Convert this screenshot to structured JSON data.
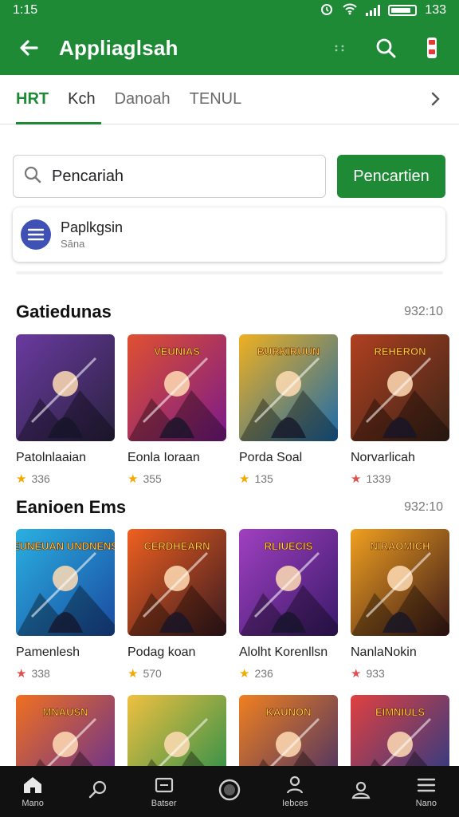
{
  "status_bar": {
    "time": "1:15",
    "battery": "133"
  },
  "app_bar": {
    "title": "Appliaglsah"
  },
  "tabs": {
    "items": [
      {
        "label": "HRT"
      },
      {
        "label": "Kch"
      },
      {
        "label": "Danoah"
      },
      {
        "label": "TENUL"
      }
    ]
  },
  "search": {
    "placeholder": "Pencariah",
    "button_label": "Pencartien"
  },
  "suggestion": {
    "title": "Paplkgsin",
    "subtitle": "Sāna"
  },
  "sections": [
    {
      "title": "Gatiedunas",
      "count": "932:10",
      "items": [
        {
          "name": "Patolnlaaian",
          "rating": "336",
          "art_label": "",
          "palette": [
            "#2a2240",
            "#6a3aa0"
          ]
        },
        {
          "name": "Eonla Ioraan",
          "rating": "355",
          "art_label": "VEUNIAS",
          "palette": [
            "#7a1a8a",
            "#e05030"
          ]
        },
        {
          "name": "Porda Soal",
          "rating": "135",
          "art_label": "BURKIRUUN",
          "palette": [
            "#1a6aaa",
            "#f0b020"
          ]
        },
        {
          "name": "Norvarlicah",
          "rating": "1339",
          "art_label": "REHERON",
          "palette": [
            "#3a2418",
            "#b04020"
          ]
        }
      ]
    },
    {
      "title": "Eanioen Ems",
      "count": "932:10",
      "items": [
        {
          "name": "Pamenlesh",
          "rating": "338",
          "art_label": "EUNEUAN UNDNENS",
          "palette": [
            "#1a4aa0",
            "#2ab0e0"
          ]
        },
        {
          "name": "Podag koan",
          "rating": "570",
          "art_label": "CERDHEARN",
          "palette": [
            "#3a1a20",
            "#f06020"
          ]
        },
        {
          "name": "Alolht Korenllsn",
          "rating": "236",
          "art_label": "RLIUECIS",
          "palette": [
            "#3a1a6a",
            "#a040c0"
          ]
        },
        {
          "name": "NanlaNokin",
          "rating": "933",
          "art_label": "NIRAOMICH",
          "palette": [
            "#3a1818",
            "#f0a020"
          ]
        }
      ]
    },
    {
      "title": "",
      "count": "",
      "items": [
        {
          "name": "",
          "rating": "",
          "art_label": "MNAUSN",
          "palette": [
            "#5a2a9a",
            "#f07020"
          ]
        },
        {
          "name": "",
          "rating": "",
          "art_label": "",
          "palette": [
            "#1a8a4a",
            "#f0c040"
          ]
        },
        {
          "name": "",
          "rating": "",
          "art_label": "KAUNON",
          "palette": [
            "#3a2a6a",
            "#f08020"
          ]
        },
        {
          "name": "",
          "rating": "",
          "art_label": "EIMNIULS",
          "palette": [
            "#1a3a8a",
            "#e04040"
          ]
        }
      ]
    }
  ],
  "bottom_nav": {
    "items": [
      {
        "label": "Mano",
        "icon": "home-icon"
      },
      {
        "label": "",
        "icon": "search-icon"
      },
      {
        "label": "Batser",
        "icon": "games-icon"
      },
      {
        "label": "",
        "icon": "circle-icon"
      },
      {
        "label": "Iebces",
        "icon": "person-icon"
      },
      {
        "label": "",
        "icon": "account-icon"
      },
      {
        "label": "Nano",
        "icon": "menu-icon"
      }
    ]
  },
  "colors": {
    "brand_green": "#1e8a36",
    "nav_bg": "#111111",
    "star": "#f2a900"
  }
}
